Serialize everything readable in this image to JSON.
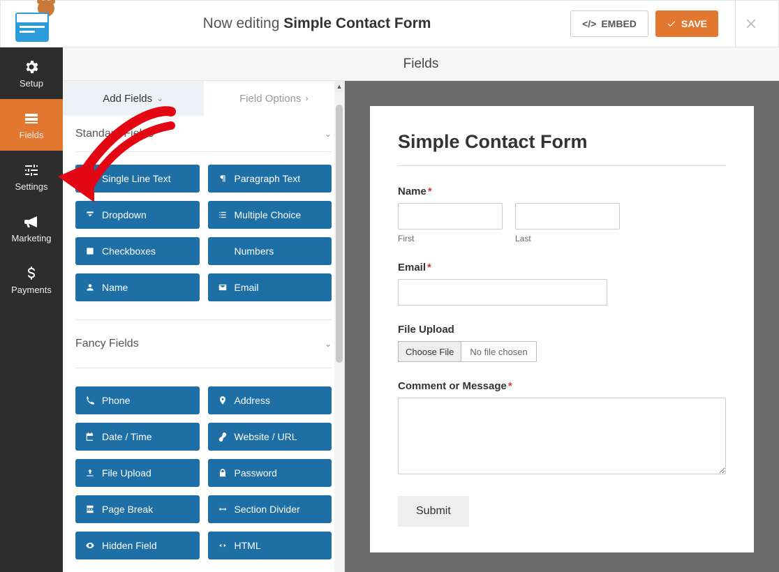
{
  "header": {
    "editing_prefix": "Now editing ",
    "editing_title": "Simple Contact Form",
    "embed_label": "EMBED",
    "save_label": "SAVE"
  },
  "rail": {
    "setup": "Setup",
    "fields": "Fields",
    "settings": "Settings",
    "marketing": "Marketing",
    "payments": "Payments"
  },
  "panel": {
    "title": "Fields"
  },
  "tabs": {
    "add": "Add Fields",
    "options": "Field Options"
  },
  "sections": {
    "standard": "Standard Fields",
    "fancy": "Fancy Fields"
  },
  "standard_fields": {
    "single_line": "Single Line Text",
    "paragraph": "Paragraph Text",
    "dropdown": "Dropdown",
    "multiple": "Multiple Choice",
    "checkboxes": "Checkboxes",
    "numbers": "Numbers",
    "name": "Name",
    "email": "Email"
  },
  "fancy_fields": {
    "phone": "Phone",
    "address": "Address",
    "datetime": "Date / Time",
    "website": "Website / URL",
    "upload": "File Upload",
    "password": "Password",
    "pagebreak": "Page Break",
    "section": "Section Divider",
    "hidden": "Hidden Field",
    "html": "HTML"
  },
  "form": {
    "title": "Simple Contact Form",
    "name_label": "Name",
    "first": "First",
    "last": "Last",
    "email_label": "Email",
    "upload_label": "File Upload",
    "choose_file": "Choose File",
    "no_file": "No file chosen",
    "comment_label": "Comment or Message",
    "submit": "Submit"
  }
}
